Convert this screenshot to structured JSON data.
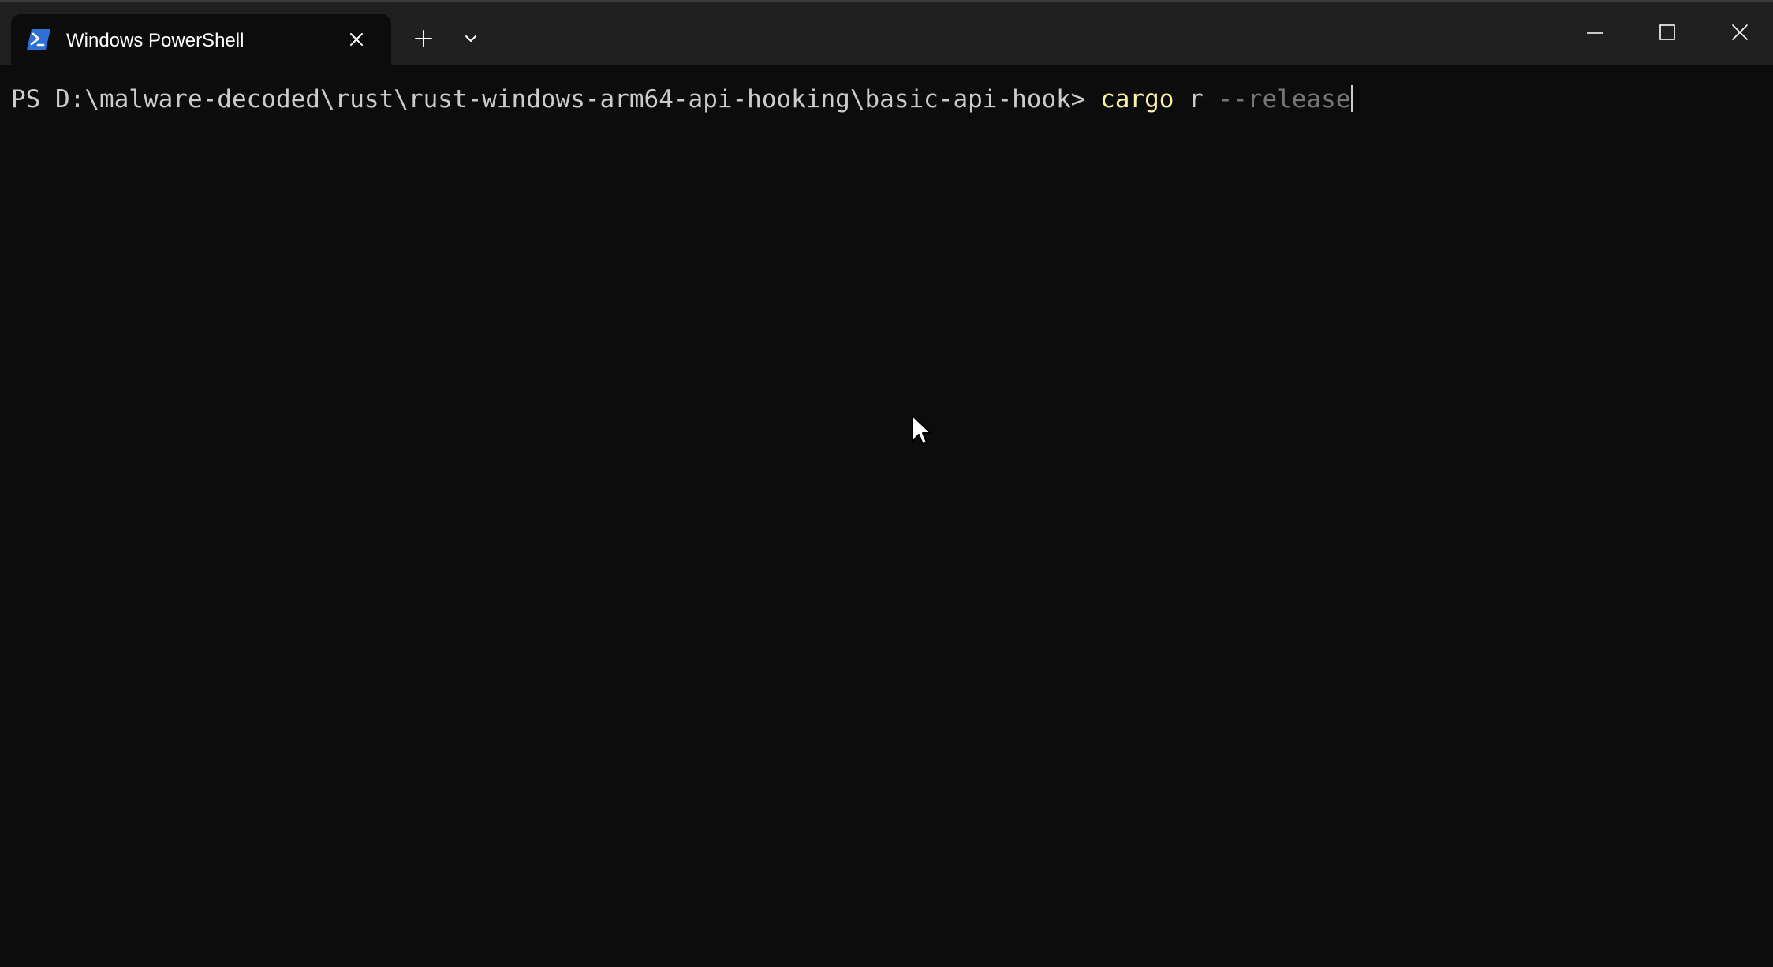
{
  "window": {
    "tab_title": "Windows PowerShell",
    "tab_icon": "powershell-icon",
    "new_tab_icon": "plus-icon",
    "dropdown_icon": "chevron-down-icon",
    "controls": [
      "minimize-icon",
      "maximize-icon",
      "close-icon"
    ]
  },
  "terminal": {
    "prompt": "PS D:\\malware-decoded\\rust\\rust-windows-arm64-api-hooking\\basic-api-hook> ",
    "command": "cargo",
    "argument": "r",
    "parameter": "--release"
  },
  "colors": {
    "background": "#0c0c0c",
    "titlebar": "#202020",
    "prompt_text": "#cccccc",
    "command_text": "#f9f1a5",
    "parameter_text": "#767676",
    "powershell_blue": "#2f6fd6"
  }
}
